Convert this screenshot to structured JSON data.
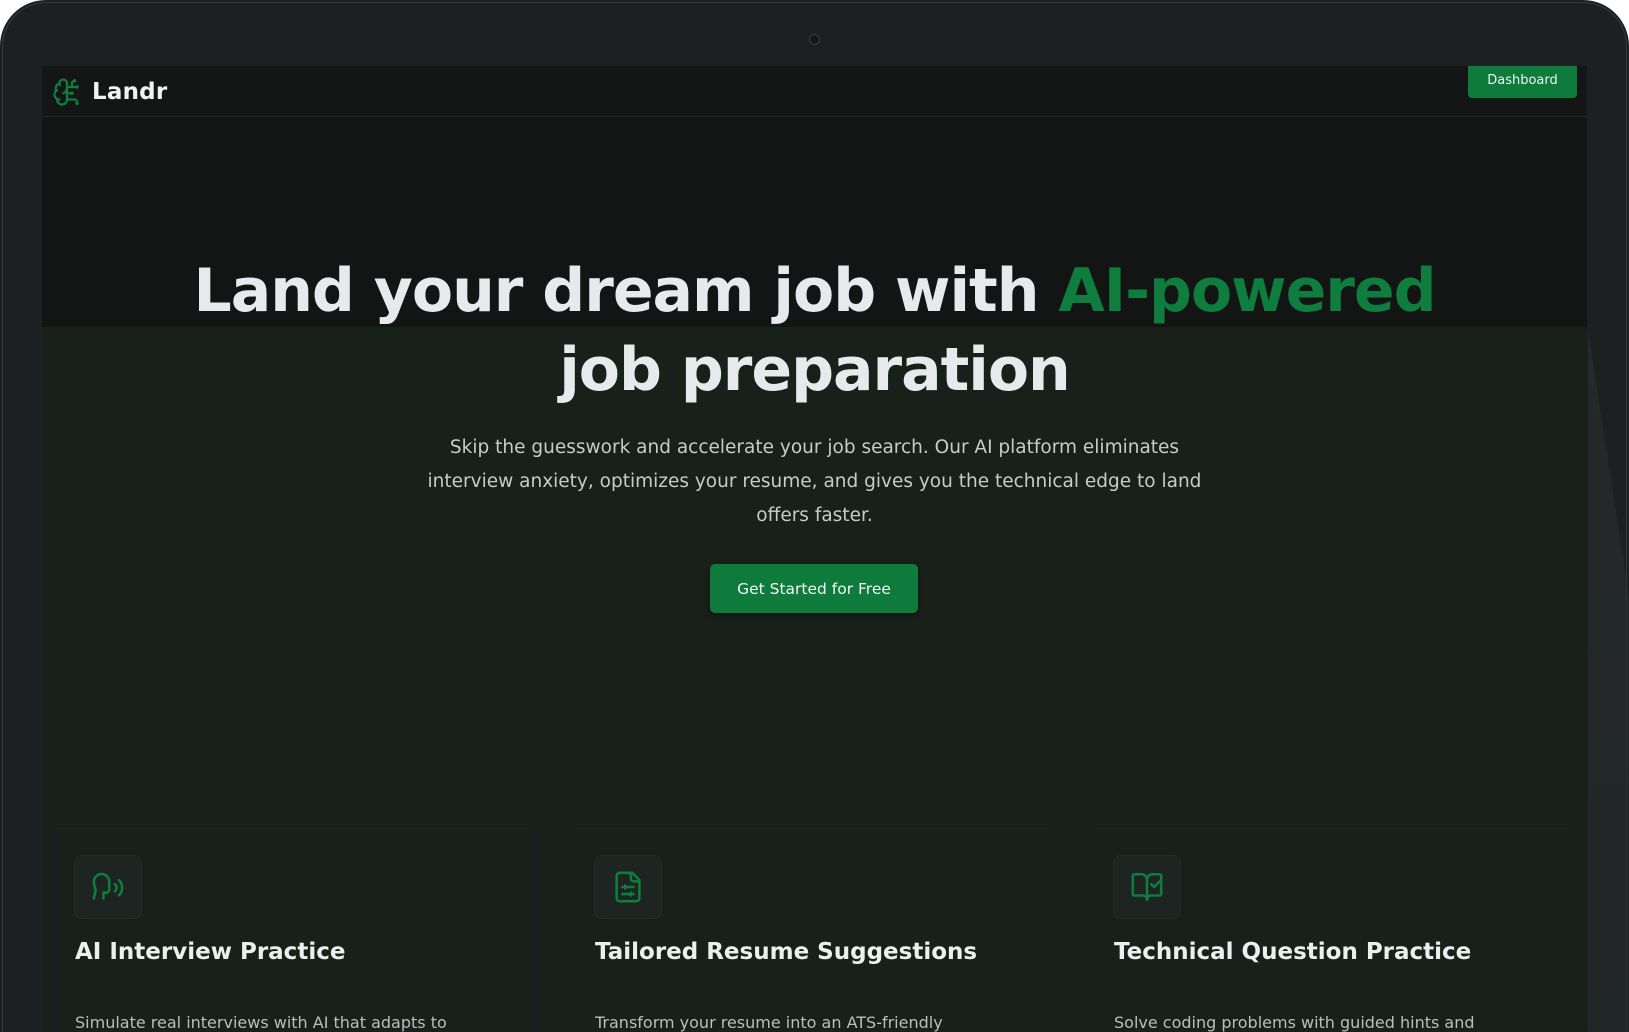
{
  "brand": {
    "name": "Landr",
    "logo_icon": "brain-icon",
    "accent": "#0f7d3e"
  },
  "nav": {
    "dashboard_label": "Dashboard"
  },
  "hero": {
    "title_before": "Land your dream job with ",
    "title_accent": "AI-powered",
    "title_after": " job preparation",
    "subtitle": "Skip the guesswork and accelerate your job search. Our AI platform eliminates interview anxiety, optimizes your resume, and gives you the technical edge to land offers faster.",
    "cta_label": "Get Started for Free"
  },
  "features": [
    {
      "icon": "speech-icon",
      "title": "AI Interview Practice",
      "desc": "Simulate real interviews with AI that adapts to"
    },
    {
      "icon": "file-sliders-icon",
      "title": "Tailored Resume Suggestions",
      "desc": "Transform your resume into an ATS-friendly"
    },
    {
      "icon": "book-check-icon",
      "title": "Technical Question Practice",
      "desc": "Solve coding problems with guided hints and"
    }
  ]
}
